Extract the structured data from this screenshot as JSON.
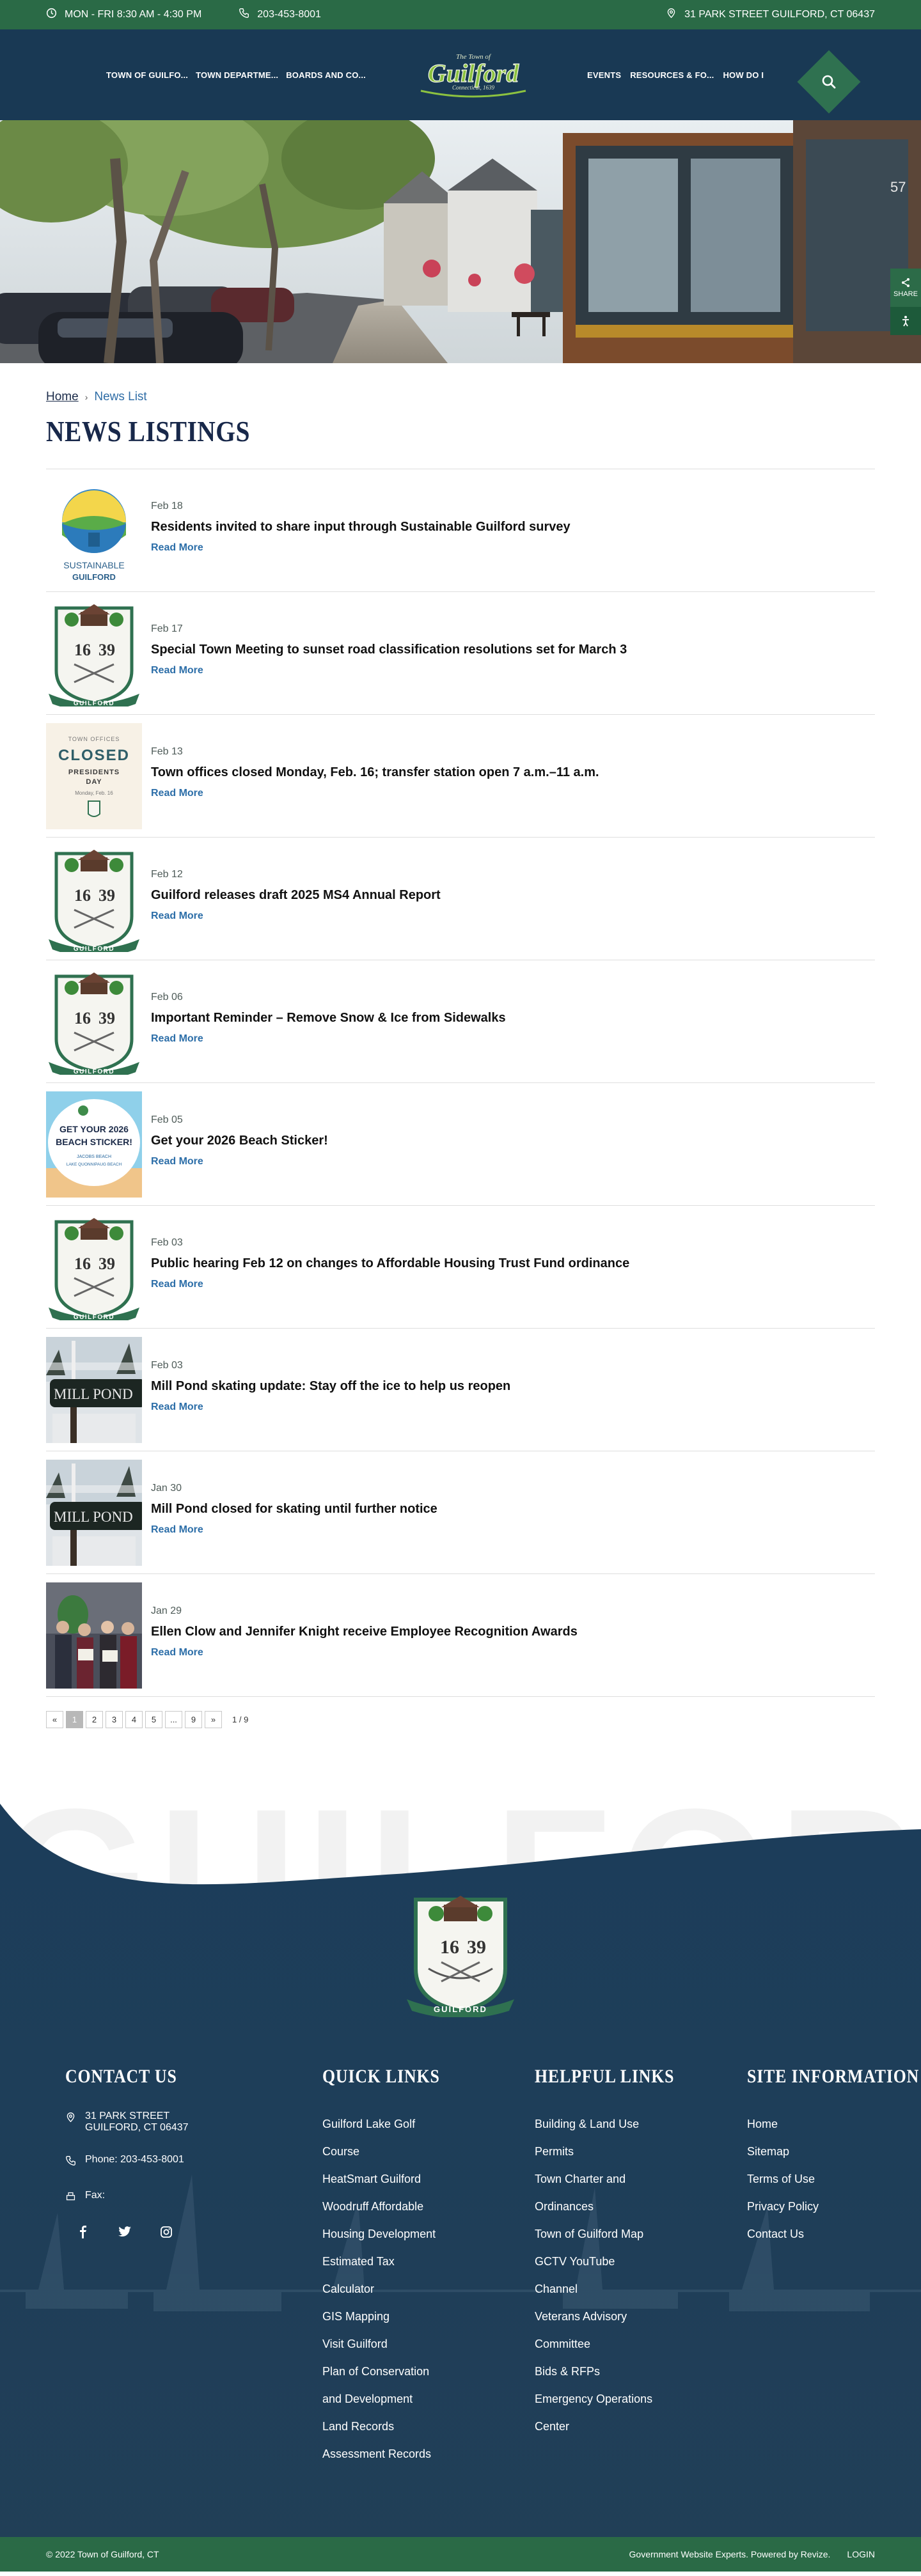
{
  "topbar": {
    "hours": "MON - FRI 8:30 AM - 4:30 PM",
    "phone": "203-453-8001",
    "address": "31 PARK STREET GUILFORD, CT 06437"
  },
  "nav": {
    "left": [
      "TOWN OF GUILFO...",
      "TOWN DEPARTME...",
      "BOARDS AND CO..."
    ],
    "right": [
      "EVENTS",
      "RESOURCES & FO...",
      "HOW DO I"
    ]
  },
  "logo": {
    "line1": "The Town of",
    "name": "Guilford",
    "line2": "Connecticut, 1639"
  },
  "hero": {
    "share_label": "SHARE"
  },
  "breadcrumb": {
    "home": "Home",
    "current": "News List"
  },
  "page_title": "NEWS LISTINGS",
  "news": [
    {
      "date": "Feb 18",
      "title": "Residents invited to share input through Sustainable Guilford survey",
      "read_more": "Read More",
      "thumb": "sustainable"
    },
    {
      "date": "Feb 17",
      "title": "Special Town Meeting to sunset road classification resolutions set for March 3",
      "read_more": "Read More",
      "thumb": "seal"
    },
    {
      "date": "Feb 13",
      "title": "Town offices closed Monday, Feb. 16; transfer station open 7 a.m.–11 a.m.",
      "read_more": "Read More",
      "thumb": "closed"
    },
    {
      "date": "Feb 12",
      "title": "Guilford releases draft 2025 MS4 Annual Report",
      "read_more": "Read More",
      "thumb": "seal"
    },
    {
      "date": "Feb 06",
      "title": "Important Reminder – Remove Snow & Ice from Sidewalks",
      "read_more": "Read More",
      "thumb": "seal"
    },
    {
      "date": "Feb 05",
      "title": "Get your 2026 Beach Sticker!",
      "read_more": "Read More",
      "thumb": "beach"
    },
    {
      "date": "Feb 03",
      "title": "Public hearing Feb 12 on changes to Affordable Housing Trust Fund ordinance",
      "read_more": "Read More",
      "thumb": "seal"
    },
    {
      "date": "Feb 03",
      "title": "Mill Pond skating update: Stay off the ice to help us reopen",
      "read_more": "Read More",
      "thumb": "millpond"
    },
    {
      "date": "Jan 30",
      "title": "Mill Pond closed for skating until further notice",
      "read_more": "Read More",
      "thumb": "millpond"
    },
    {
      "date": "Jan 29",
      "title": "Ellen Clow and Jennifer Knight receive Employee Recognition Awards",
      "read_more": "Read More",
      "thumb": "people"
    }
  ],
  "thumb_text": {
    "sustainable_line1": "SUSTAINABLE",
    "sustainable_line2": "GUILFORD",
    "closed_small": "TOWN OFFICES",
    "closed_big": "CLOSED",
    "closed_holiday": "PRESIDENTS",
    "closed_day": "DAY",
    "closed_date": "Monday, Feb. 16",
    "beach_line1": "GET YOUR 2026",
    "beach_line2": "BEACH STICKER!",
    "beach_small": "JACOBS BEACH",
    "beach_small2": "LAKE QUONNIPAUG BEACH",
    "millpond": "MILL POND",
    "seal_year_a": "16",
    "seal_year_b": "39",
    "seal_ribbon": "GUILFORD"
  },
  "pagination": {
    "prev": "«",
    "pages": [
      "1",
      "2",
      "3",
      "4",
      "5",
      "...",
      "9"
    ],
    "next": "»",
    "info": "1 / 9"
  },
  "footer": {
    "watermark": "GUILFORD",
    "contact": {
      "heading": "CONTACT US",
      "address_line1": "31 PARK STREET",
      "address_line2": "GUILFORD, CT 06437",
      "phone": "Phone: 203-453-8001",
      "fax": "Fax:"
    },
    "quick_links": {
      "heading": "QUICK LINKS",
      "items": [
        "Guilford Lake Golf",
        "Course",
        "HeatSmart Guilford",
        "Woodruff Affordable",
        "Housing Development",
        "Estimated Tax",
        "Calculator",
        "GIS Mapping",
        "Visit Guilford",
        "Plan of Conservation",
        "and Development",
        "Land Records",
        "Assessment Records"
      ]
    },
    "helpful_links": {
      "heading": "HELPFUL LINKS",
      "items": [
        "Building & Land Use",
        "Permits",
        "Town Charter and",
        "Ordinances",
        "Town of Guilford Map",
        "GCTV YouTube",
        "Channel",
        "Veterans Advisory",
        "Committee",
        "Bids & RFPs",
        "Emergency Operations",
        "Center"
      ]
    },
    "site_info": {
      "heading": "SITE INFORMATION",
      "items": [
        "Home",
        "Sitemap",
        "Terms of Use",
        "Privacy Policy",
        "Contact Us"
      ]
    },
    "copyright": "© 2022 Town of Guilford, CT",
    "powered": "Government Website Experts. Powered by Revize.",
    "login": "LOGIN"
  },
  "colors": {
    "green_bar": "#2a6a46",
    "navy": "#193954",
    "link_blue": "#2c6ea8"
  }
}
